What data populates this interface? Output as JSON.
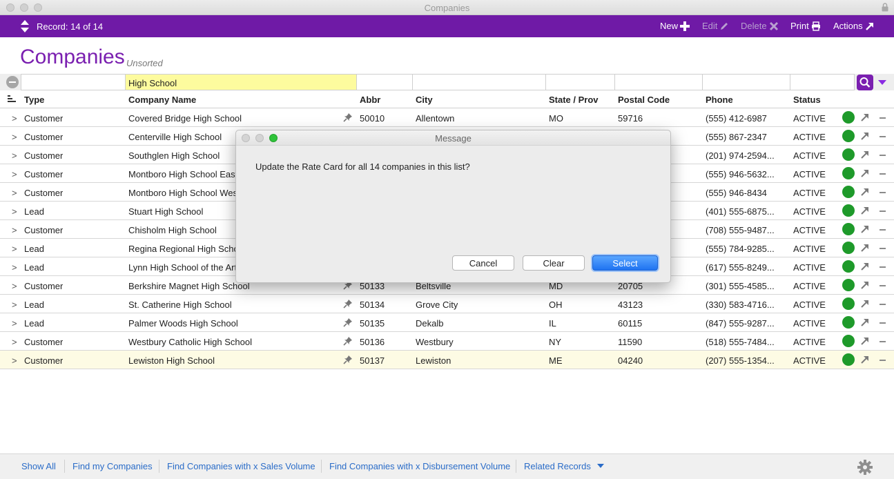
{
  "window": {
    "title": "Companies"
  },
  "toolbar": {
    "record_label": "Record: 14 of 14",
    "new_label": "New",
    "edit_label": "Edit",
    "delete_label": "Delete",
    "print_label": "Print",
    "actions_label": "Actions"
  },
  "header": {
    "title": "Companies",
    "sort_state": "Unsorted"
  },
  "find": {
    "company_name_value": "High School"
  },
  "columns": {
    "type": "Type",
    "company_name": "Company Name",
    "abbr": "Abbr",
    "city": "City",
    "state": "State / Prov",
    "postal": "Postal Code",
    "phone": "Phone",
    "status": "Status"
  },
  "rows": [
    {
      "chevron": ">",
      "type": "Customer",
      "name": "Covered Bridge High School",
      "abbr": "50010",
      "city": "Allentown",
      "state": "MO",
      "postal": "59716",
      "phone": "(555) 412-6987",
      "status": "ACTIVE"
    },
    {
      "chevron": ">",
      "type": "Customer",
      "name": "Centerville High School",
      "abbr": "",
      "city": "",
      "state": "",
      "postal": "",
      "phone": "(555) 867-2347",
      "status": "ACTIVE"
    },
    {
      "chevron": ">",
      "type": "Customer",
      "name": "Southglen High School",
      "abbr": "",
      "city": "",
      "state": "",
      "postal": "",
      "phone": "(201) 974-2594...",
      "status": "ACTIVE"
    },
    {
      "chevron": ">",
      "type": "Customer",
      "name": "Montboro High School East",
      "abbr": "",
      "city": "",
      "state": "",
      "postal": "",
      "phone": "(555) 946-5632...",
      "status": "ACTIVE"
    },
    {
      "chevron": ">",
      "type": "Customer",
      "name": "Montboro High School West",
      "abbr": "",
      "city": "",
      "state": "",
      "postal": "",
      "phone": "(555) 946-8434",
      "status": "ACTIVE"
    },
    {
      "chevron": ">",
      "type": "Lead",
      "name": "Stuart High School",
      "abbr": "",
      "city": "",
      "state": "",
      "postal": "",
      "phone": "(401) 555-6875...",
      "status": "ACTIVE"
    },
    {
      "chevron": ">",
      "type": "Customer",
      "name": "Chisholm High School",
      "abbr": "",
      "city": "",
      "state": "",
      "postal": "",
      "phone": "(708) 555-9487...",
      "status": "ACTIVE"
    },
    {
      "chevron": ">",
      "type": "Lead",
      "name": "Regina Regional High School",
      "abbr": "",
      "city": "",
      "state": "",
      "postal": "",
      "phone": "(555) 784-9285...",
      "status": "ACTIVE"
    },
    {
      "chevron": ">",
      "type": "Lead",
      "name": "Lynn High School of the Arts",
      "abbr": "",
      "city": "",
      "state": "",
      "postal": "",
      "phone": "(617) 555-8249...",
      "status": "ACTIVE"
    },
    {
      "chevron": ">",
      "type": "Customer",
      "name": "Berkshire Magnet High School",
      "abbr": "50133",
      "city": "Beltsville",
      "state": "MD",
      "postal": "20705",
      "phone": "(301) 555-4585...",
      "status": "ACTIVE"
    },
    {
      "chevron": ">",
      "type": "Lead",
      "name": "St. Catherine High School",
      "abbr": "50134",
      "city": "Grove City",
      "state": "OH",
      "postal": "43123",
      "phone": "(330) 583-4716...",
      "status": "ACTIVE"
    },
    {
      "chevron": ">",
      "type": "Lead",
      "name": "Palmer Woods High School",
      "abbr": "50135",
      "city": "Dekalb",
      "state": "IL",
      "postal": "60115",
      "phone": "(847) 555-9287...",
      "status": "ACTIVE"
    },
    {
      "chevron": ">",
      "type": "Customer",
      "name": "Westbury Catholic High School",
      "abbr": "50136",
      "city": "Westbury",
      "state": "NY",
      "postal": "11590",
      "phone": "(518) 555-7484...",
      "status": "ACTIVE"
    },
    {
      "chevron": ">",
      "type": "Customer",
      "name": "Lewiston High School",
      "abbr": "50137",
      "city": "Lewiston",
      "state": "ME",
      "postal": "04240",
      "phone": "(207) 555-1354...",
      "status": "ACTIVE"
    }
  ],
  "modal": {
    "title": "Message",
    "message": "Update the Rate Card for all 14 companies in this list?",
    "cancel_label": "Cancel",
    "clear_label": "Clear",
    "select_label": "Select"
  },
  "footer": {
    "show_all": "Show All",
    "find_my": "Find my Companies",
    "find_sales": "Find Companies with x Sales Volume",
    "find_disbursement": "Find Companies with x Disbursement Volume",
    "related": "Related Records"
  },
  "colors": {
    "brand_purple": "#6f1aa6",
    "heading_purple": "#7a1fb0",
    "status_green": "#1e9a2a",
    "find_highlight": "#fdfb9e",
    "link_blue": "#2a6cc8"
  },
  "icons": {
    "nav": "up-down-arrows-icon",
    "new": "plus-icon",
    "edit": "pencil-icon",
    "delete": "x-icon",
    "print": "printer-icon",
    "actions": "arrow-up-right-icon",
    "search": "magnifier-icon",
    "pin": "pushpin-icon",
    "settings": "gear-icon"
  }
}
